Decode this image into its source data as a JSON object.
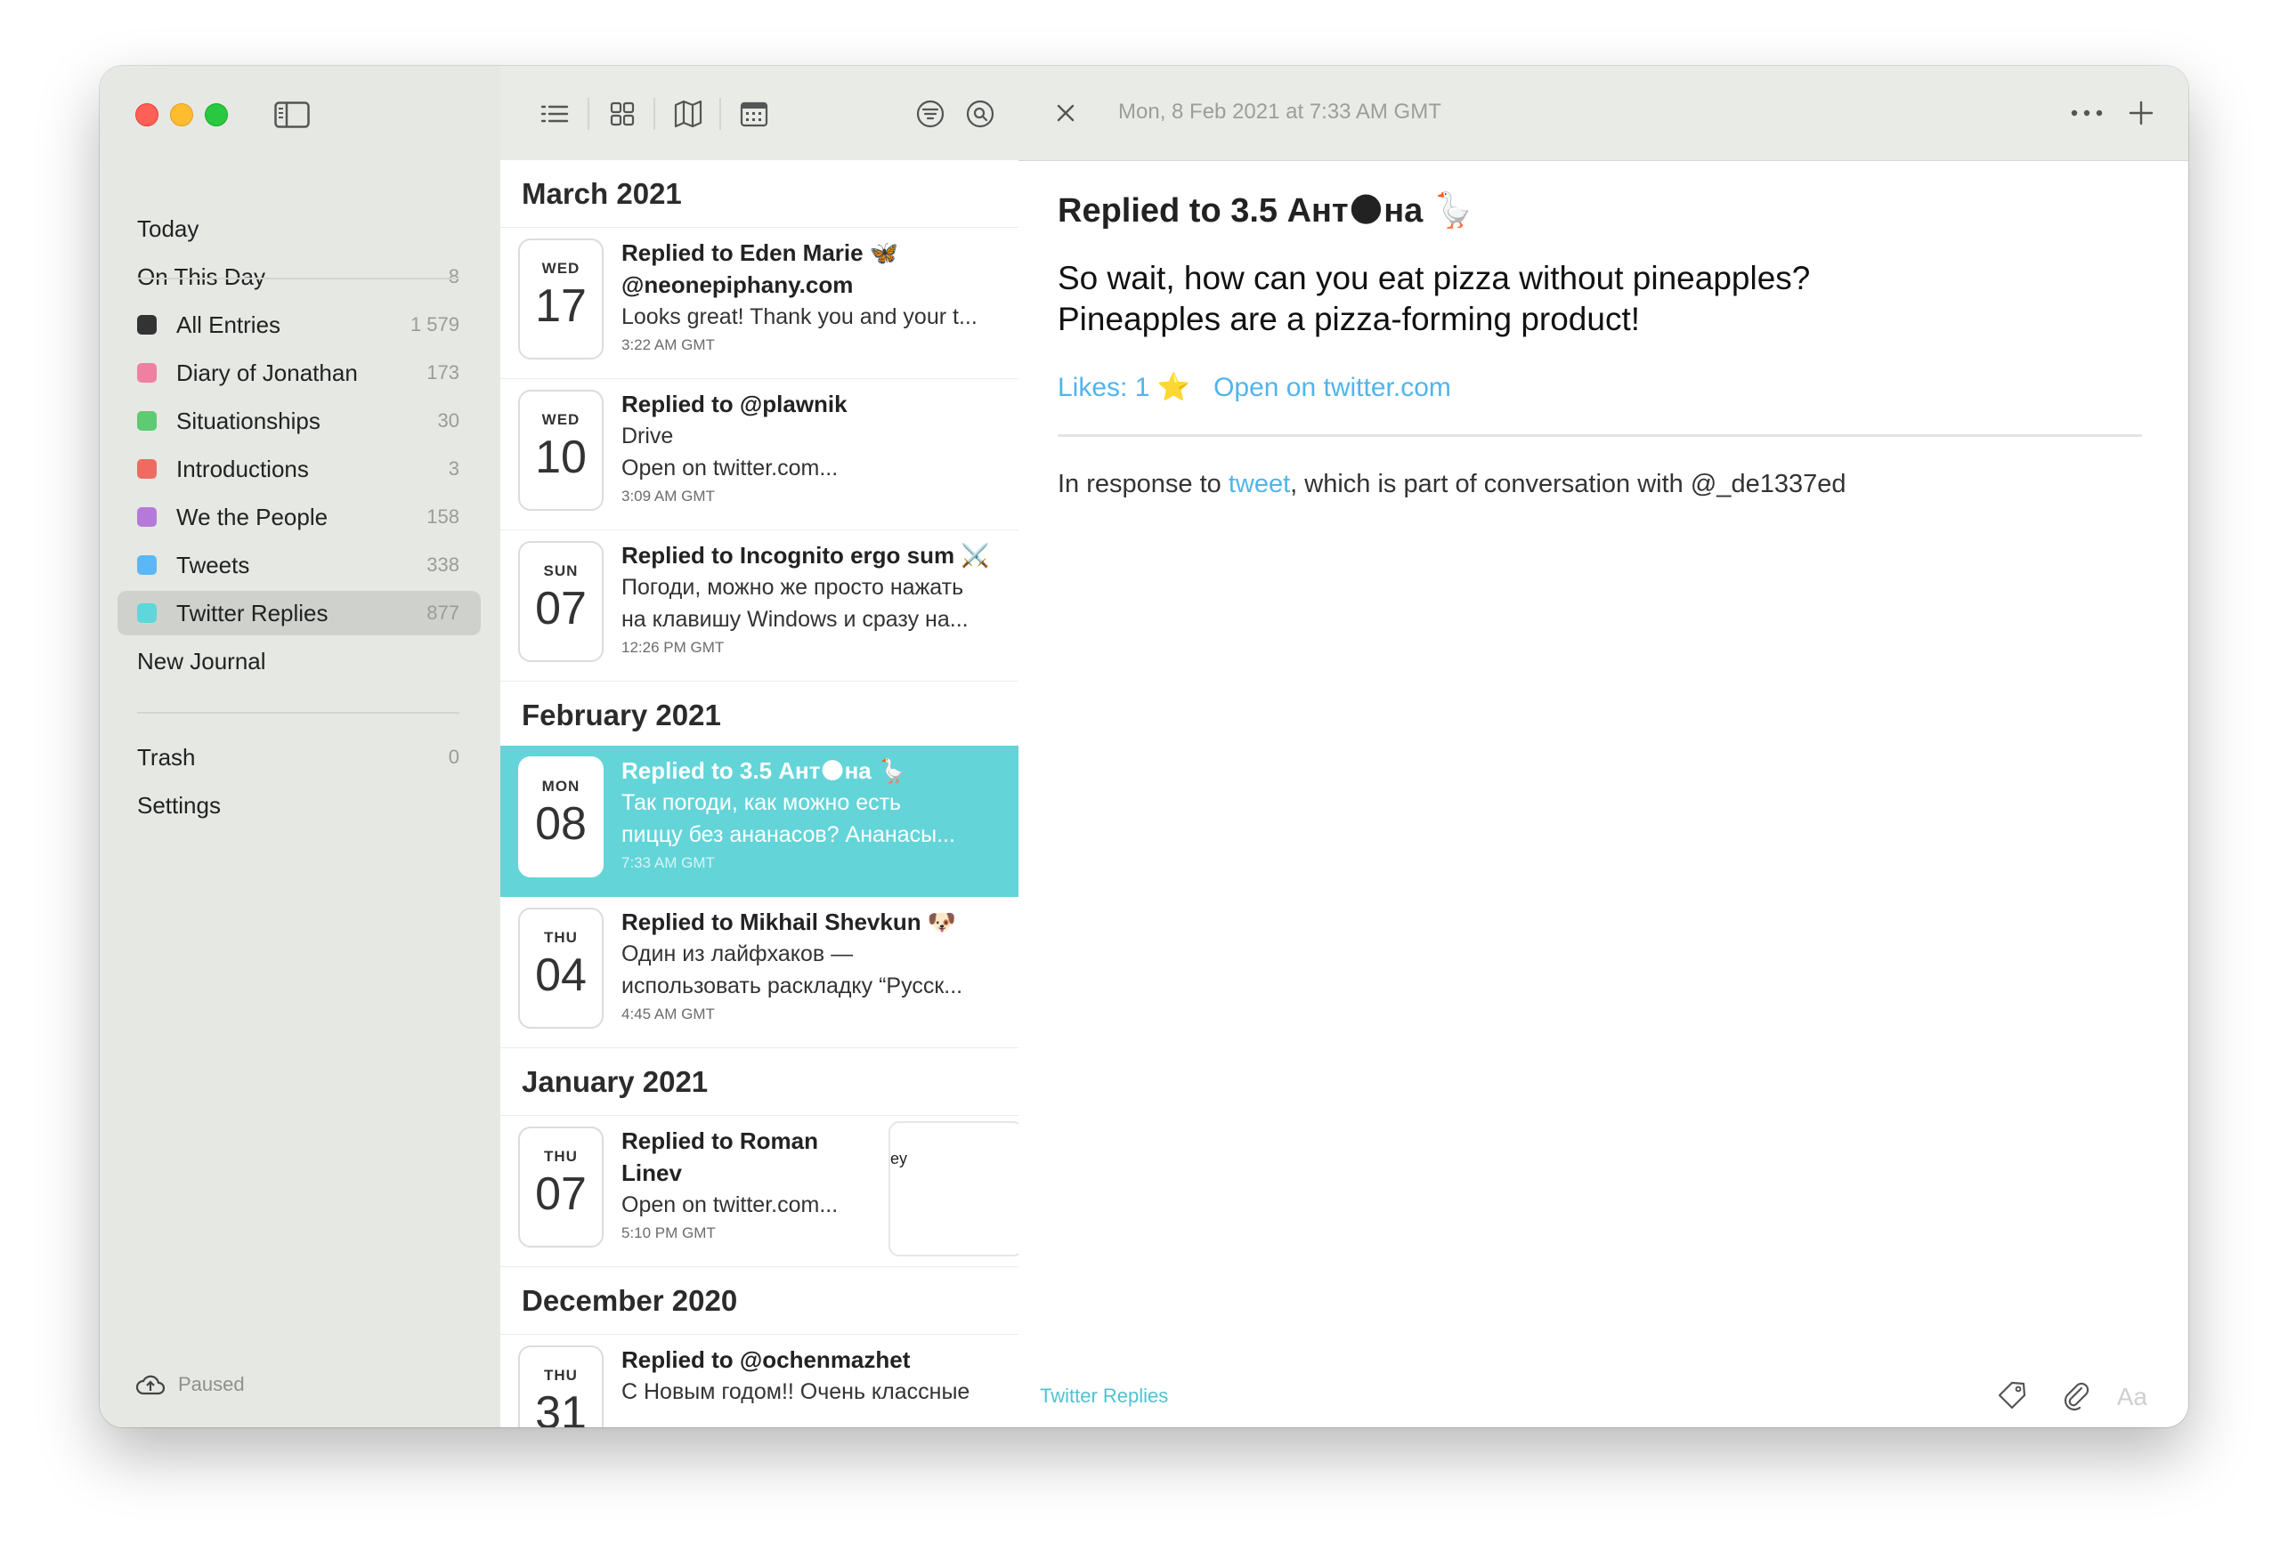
{
  "sidebar": {
    "top_items": [
      {
        "label": "Today",
        "count": ""
      },
      {
        "label": "On This Day",
        "count": "8"
      }
    ],
    "journals": [
      {
        "label": "All Entries",
        "count": "1 579",
        "color": "#333333"
      },
      {
        "label": "Diary of Jonathan",
        "count": "173",
        "color": "#f17fa1"
      },
      {
        "label": "Situationships",
        "count": "30",
        "color": "#5ccb72"
      },
      {
        "label": "Introductions",
        "count": "3",
        "color": "#ef6b62"
      },
      {
        "label": "We the People",
        "count": "158",
        "color": "#b57ad9"
      },
      {
        "label": "Tweets",
        "count": "338",
        "color": "#5bb8f5"
      },
      {
        "label": "Twitter Replies",
        "count": "877",
        "color": "#5fd6da",
        "selected": true
      }
    ],
    "new_journal_label": "New Journal",
    "bottom_items": [
      {
        "label": "Trash",
        "count": "0"
      },
      {
        "label": "Settings",
        "count": ""
      }
    ],
    "sync_status": "Paused"
  },
  "list": {
    "toolbar_icons": [
      "list-view-icon",
      "grid-view-icon",
      "map-view-icon",
      "calendar-view-icon",
      "filter-icon",
      "search-icon"
    ],
    "months": [
      "March 2021",
      "February 2021",
      "January 2021",
      "December 2020"
    ],
    "entries": [
      {
        "dow": "WED",
        "day": "17",
        "title": "Replied to Eden Marie 🦋",
        "line2": "@neonepiphany.com",
        "line3": "Looks great! Thank you and your t...",
        "time": "3:22 AM GMT"
      },
      {
        "dow": "WED",
        "day": "10",
        "title": "Replied to @plawnik",
        "line2": "Drive",
        "line3": "Open on twitter.com...",
        "time": "3:09 AM GMT"
      },
      {
        "dow": "SUN",
        "day": "07",
        "title": "Replied to Incognito ergo sum ⚔️",
        "line2": "Погоди, можно же просто нажать",
        "line3": "на клавишу Windows и сразу на...",
        "time": "12:26 PM GMT"
      },
      {
        "dow": "MON",
        "day": "08",
        "title": "Replied to 3.5 Ант🌑на 🪿",
        "line2": "Так погоди, как можно есть",
        "line3": "пиццу без ананасов? Ананасы...",
        "time": "7:33 AM GMT",
        "selected": true
      },
      {
        "dow": "THU",
        "day": "04",
        "title": "Replied to Mikhail Shevkun 🐶",
        "line2": "Один из лайфхаков —",
        "line3": "использовать раскладку “Русск...",
        "time": "4:45 AM GMT"
      },
      {
        "dow": "THU",
        "day": "07",
        "title": "Replied to Roman",
        "line2": "Linev",
        "line3": "Open on twitter.com...",
        "time": "5:10 PM GMT",
        "thumb_text": "ley"
      },
      {
        "dow": "THU",
        "day": "31",
        "title": "Replied to @ochenmazhet",
        "line2": "С Новым годом!! Очень классные",
        "line3": "",
        "time": ""
      }
    ]
  },
  "detail": {
    "date": "Mon, 8 Feb 2021 at 7:33 AM GMT",
    "title": "Replied to 3.5 Ант🌑на 🪿",
    "body_line1": "So wait, how can you eat pizza without pineapples?",
    "body_line2": "Pineapples are a pizza-forming product!",
    "likes": "Likes: 1 ⭐️",
    "open_link": "Open on twitter.com",
    "response_prefix": "In response to ",
    "response_link": "tweet",
    "response_suffix": ", which is part of conversation with @_de1337ed",
    "journal": "Twitter Replies",
    "format_label": "Aa"
  }
}
